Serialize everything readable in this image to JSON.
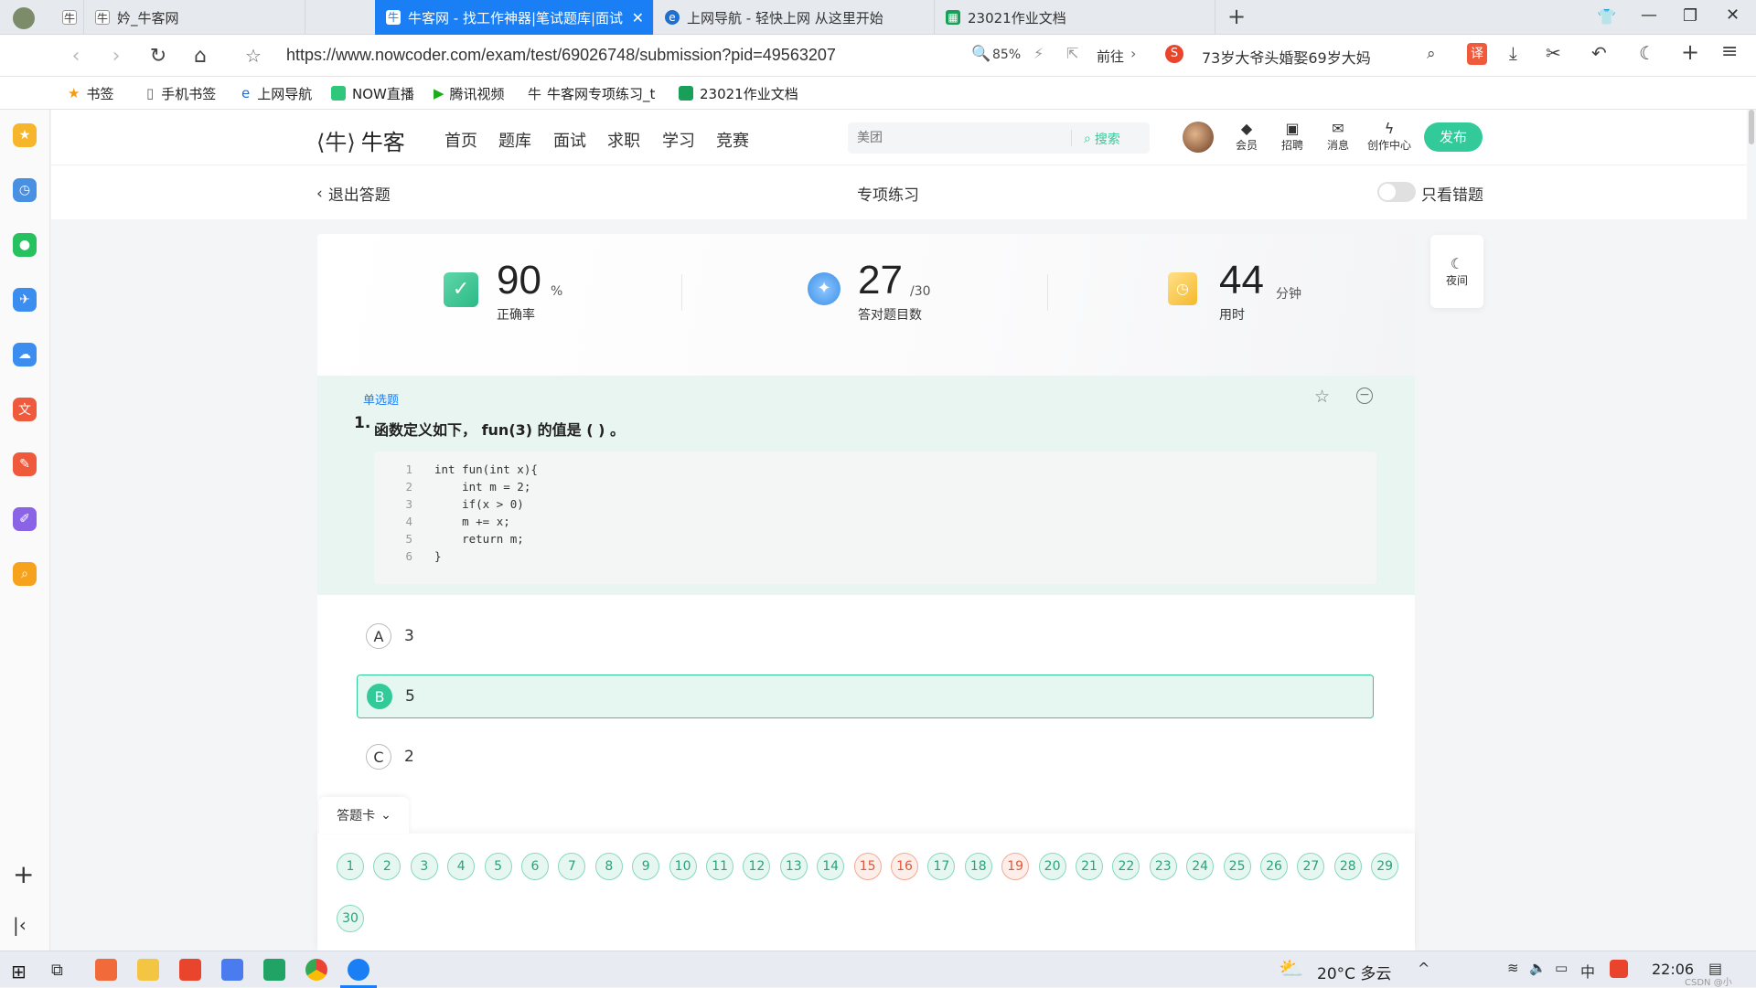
{
  "tabs": [
    {
      "label": "",
      "icon": "nowcoder-icon"
    },
    {
      "label": "妗_牛客网",
      "icon": "nowcoder-icon"
    },
    {
      "label": "牛客网 - 找工作神器|笔试题库|面试",
      "icon": "nowcoder-icon",
      "active": true
    },
    {
      "label": "上网导航 - 轻快上网 从这里开始",
      "icon": "ie-icon"
    },
    {
      "label": "23021作业文档",
      "icon": "sheet-icon"
    }
  ],
  "new_tab": "+",
  "address": {
    "url": "https://www.nowcoder.com/exam/test/69026748/submission?pid=49563207",
    "zoom": "85%",
    "goto": "前往",
    "hot_search": "73岁大爷头婚娶69岁大妈",
    "translate": "译"
  },
  "bookmarks": [
    "书签",
    "手机书签",
    "上网导航",
    "NOW直播",
    "腾讯视频",
    "牛客网专项练习_t",
    "23021作业文档"
  ],
  "site": {
    "logo": "牛客",
    "menu": [
      "首页",
      "题库",
      "面试",
      "求职",
      "学习",
      "竞赛"
    ],
    "search_placeholder": "美团",
    "search_button": "搜索",
    "icons": [
      {
        "label": "会员"
      },
      {
        "label": "招聘"
      },
      {
        "label": "消息"
      },
      {
        "label": "创作中心"
      }
    ],
    "publish": "发布"
  },
  "subbar": {
    "exit": "退出答题",
    "title": "专项练习",
    "only_wrong": "只看错题"
  },
  "night": "夜间",
  "stats": [
    {
      "value": "90",
      "unit": "%",
      "label": "正确率"
    },
    {
      "value": "27",
      "unit": "/30",
      "label": "答对题目数"
    },
    {
      "value": "44",
      "unit": "分钟",
      "label": "用时"
    }
  ],
  "question": {
    "type": "单选题",
    "number": "1.",
    "text": "函数定义如下， fun(3) 的值是 ( ) 。",
    "code": [
      {
        "n": "1",
        "t": "int fun(int x){"
      },
      {
        "n": "2",
        "t": "    int m = 2;"
      },
      {
        "n": "3",
        "t": "    if(x > 0)"
      },
      {
        "n": "4",
        "t": "    m += x;"
      },
      {
        "n": "5",
        "t": "    return m;"
      },
      {
        "n": "6",
        "t": "}"
      }
    ],
    "options": [
      {
        "letter": "A",
        "text": "3",
        "selected": false
      },
      {
        "letter": "B",
        "text": "5",
        "selected": true
      },
      {
        "letter": "C",
        "text": "2",
        "selected": false
      }
    ]
  },
  "answer_card": {
    "label": "答题卡",
    "items": [
      "1",
      "2",
      "3",
      "4",
      "5",
      "6",
      "7",
      "8",
      "9",
      "10",
      "11",
      "12",
      "13",
      "14",
      "15",
      "16",
      "17",
      "18",
      "19",
      "20",
      "21",
      "22",
      "23",
      "24",
      "25",
      "26",
      "27",
      "28",
      "29",
      "30"
    ],
    "wrong": [
      "15",
      "16",
      "19"
    ]
  },
  "taskbar": {
    "weather": "20°C 多云",
    "time": "22:06",
    "ime": "中",
    "watermark": "CSDN @小"
  },
  "colors": {
    "accent": "#32ca99",
    "tab_active": "#1a7ff5",
    "wrong": "#e0573a"
  }
}
